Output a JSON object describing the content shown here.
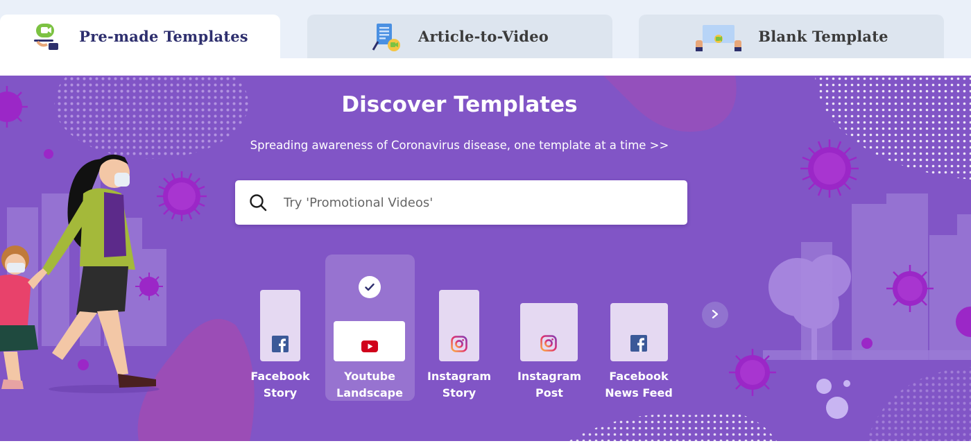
{
  "tabs": [
    {
      "label": "Pre-made Templates",
      "icon": "video-tray-icon",
      "active": true
    },
    {
      "label": "Article-to-Video",
      "icon": "article-video-icon",
      "active": false
    },
    {
      "label": "Blank Template",
      "icon": "blank-canvas-icon",
      "active": false
    }
  ],
  "hero": {
    "title": "Discover Templates",
    "subtitle": "Spreading awareness of Coronavirus disease, one template at a time >>"
  },
  "search": {
    "placeholder": "Try 'Promotional Videos'"
  },
  "template_options": [
    {
      "line1": "Facebook",
      "line2": "Story",
      "icon": "facebook-icon",
      "selected": false
    },
    {
      "line1": "Youtube",
      "line2": "Landscape",
      "icon": "youtube-icon",
      "selected": true
    },
    {
      "line1": "Instagram",
      "line2": "Story",
      "icon": "instagram-icon",
      "selected": false
    },
    {
      "line1": "Instagram",
      "line2": "Post",
      "icon": "instagram-icon",
      "selected": false
    },
    {
      "line1": "Facebook",
      "line2": "News Feed",
      "icon": "facebook-icon",
      "selected": false
    }
  ],
  "colors": {
    "banner": "#8155c6",
    "virus": "#9b27c7",
    "facebook": "#3b5998",
    "youtube": "#d0021b",
    "instagram": "#d6249f"
  }
}
